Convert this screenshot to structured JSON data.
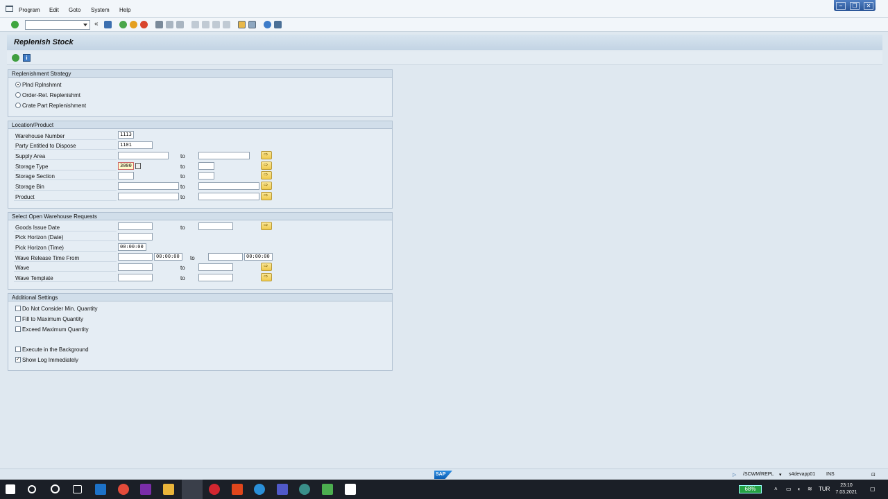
{
  "menubar": {
    "items": [
      "Program",
      "Edit",
      "Goto",
      "System",
      "Help"
    ]
  },
  "window_controls": [
    "–",
    "❐",
    "✕"
  ],
  "toolbar": {
    "command_field_value": "",
    "icons": [
      "enter-icon",
      "back-arrows-icon",
      "save-icon",
      "back-icon",
      "exit-icon",
      "cancel-icon",
      "print-icon",
      "find-icon",
      "find-next-icon",
      "first-page-icon",
      "prev-page-icon",
      "next-page-icon",
      "last-page-icon",
      "new-session-icon",
      "shortcut-icon",
      "help-icon",
      "customize-icon"
    ]
  },
  "page": {
    "title": "Replenish Stock",
    "app_toolbar_icons": [
      "execute-icon",
      "info-icon"
    ]
  },
  "groups": {
    "strategy": {
      "header": "Replenishment Strategy",
      "options": [
        {
          "label": "Plnd Rplnshmnt",
          "selected": true
        },
        {
          "label": "Order-Rel. Replenishmt",
          "selected": false
        },
        {
          "label": "Crate Part Replenishment",
          "selected": false
        }
      ]
    },
    "location": {
      "header": "Location/Product",
      "to_label": "to",
      "fields": [
        {
          "label": "Warehouse Number",
          "value": "1113"
        },
        {
          "label": "Party Entitled to Dispose",
          "value": "1101"
        },
        {
          "label": "Supply Area",
          "value": "",
          "to_value": ""
        },
        {
          "label": "Storage Type",
          "value": "3000",
          "to_value": ""
        },
        {
          "label": "Storage Section",
          "value": "",
          "to_value": ""
        },
        {
          "label": "Storage Bin",
          "value": "",
          "to_value": ""
        },
        {
          "label": "Product",
          "value": "",
          "to_value": ""
        }
      ]
    },
    "requests": {
      "header": "Select Open Warehouse Requests",
      "to_label": "to",
      "fields": [
        {
          "label": "Goods Issue Date",
          "value": "",
          "to_value": ""
        },
        {
          "label": "Pick Horizon (Date)",
          "value": ""
        },
        {
          "label": "Pick Horizon (Time)",
          "value": "00:00:00"
        },
        {
          "label": "Wave Release Time From",
          "value": "",
          "time_from": "00:00:00",
          "to_value": "",
          "time_to": "00:00:00"
        },
        {
          "label": "Wave",
          "value": "",
          "to_value": ""
        },
        {
          "label": "Wave Template",
          "value": "",
          "to_value": ""
        }
      ]
    },
    "settings": {
      "header": "Additional Settings",
      "checkboxes": [
        {
          "label": "Do Not Consider Min. Quantity",
          "checked": false
        },
        {
          "label": "Fill to Maximum Quantity",
          "checked": false
        },
        {
          "label": "Exceed Maximum Quantity",
          "checked": false
        },
        {
          "label": "Execute in the Background",
          "checked": false
        },
        {
          "label": "Show Log Immediately",
          "checked": true
        }
      ]
    }
  },
  "statusbar": {
    "logo": "SAP",
    "transaction": "/SCWM/REPL",
    "server": "s4devapp01",
    "mode": "INS"
  },
  "taskbar": {
    "battery": "68%",
    "language": "TUR",
    "time": "23:10",
    "date": "7.03.2021"
  },
  "colors": {
    "sap_bg": "#dfe8f0",
    "group_header": "#d1deea",
    "required_field": "#fff9c9",
    "taskbar": "#1b1f27"
  }
}
